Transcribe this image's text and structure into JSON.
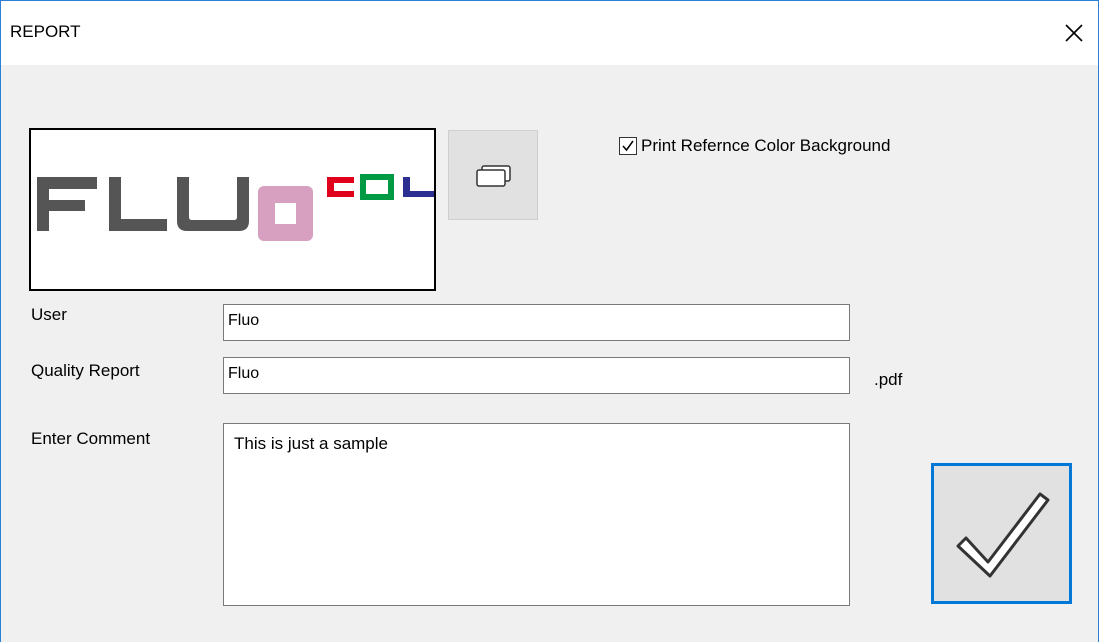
{
  "window": {
    "title": "REPORT"
  },
  "logo": {
    "text_main": "FLU",
    "text_colored": [
      "C",
      "O",
      "L"
    ],
    "colors": [
      "#555555",
      "#d48fb0",
      "#e0001b",
      "#009a44",
      "#2b2f8f"
    ]
  },
  "browse_button": {
    "icon": "browse-icon"
  },
  "checkbox": {
    "label": "Print Refernce Color Background",
    "checked": true
  },
  "fields": {
    "user": {
      "label": "User",
      "value": "Fluo"
    },
    "quality_report": {
      "label": "Quality Report",
      "value": "Fluo",
      "extension": ".pdf"
    },
    "comment": {
      "label": "Enter Comment",
      "value": "This is just a sample"
    }
  },
  "ok_button": {
    "icon": "checkmark-icon",
    "accent": "#0078d7"
  }
}
